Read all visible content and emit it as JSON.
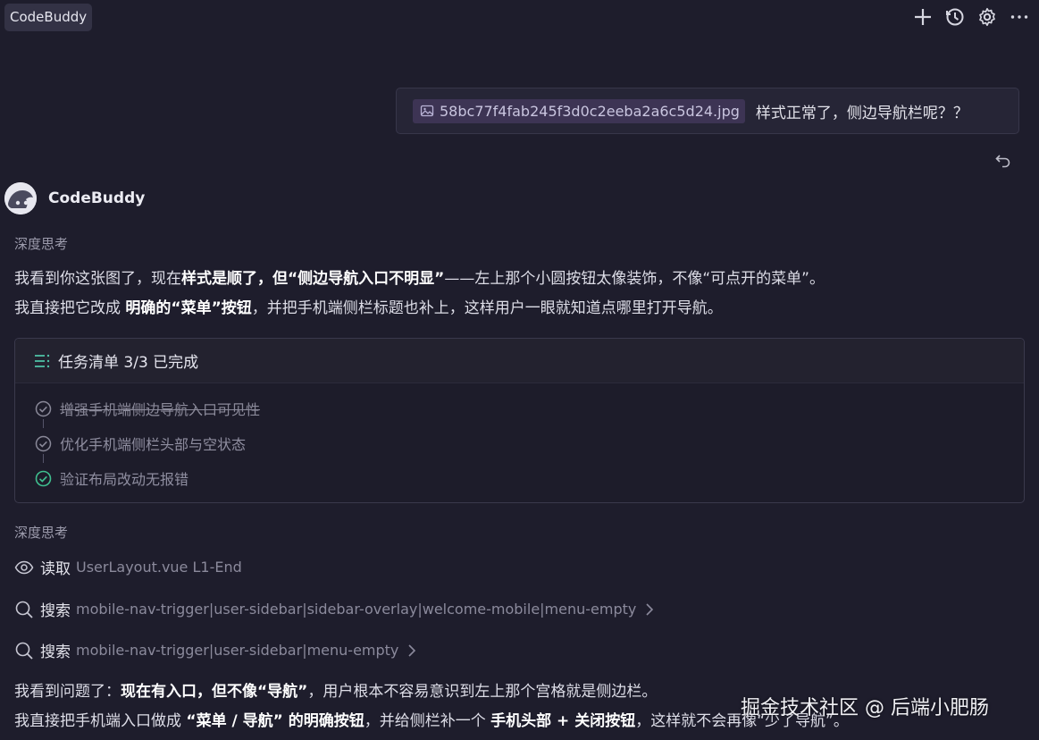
{
  "app": {
    "title": "CodeBuddy"
  },
  "toolbar": {
    "icons": [
      "plus-icon",
      "history-icon",
      "gear-icon",
      "more-icon"
    ]
  },
  "user_message": {
    "attachment": "58bc77f4fab245f3d0c2eeba2a6c5d24.jpg",
    "text": "样式正常了，侧边导航栏呢？？"
  },
  "assistant": {
    "name": "CodeBuddy",
    "thinking_label_1": "深度思考",
    "para1": {
      "line1": [
        {
          "t": "我看到你这张图了，现在",
          "b": false
        },
        {
          "t": "样式是顺了，但“侧边导航入口不明显”",
          "b": true
        },
        {
          "t": "——左上那个小圆按钮太像装饰，不像“可点开的菜单”。",
          "b": false
        }
      ],
      "line2": [
        {
          "t": "我直接把它改成 ",
          "b": false
        },
        {
          "t": "明确的“菜单”按钮",
          "b": true
        },
        {
          "t": "，并把手机端侧栏标题也补上，这样用户一眼就知道点哪里打开导航。",
          "b": false
        }
      ]
    },
    "tasklist": {
      "title": "任务清单 3/3 已完成",
      "items": [
        {
          "label": "增强手机端侧边导航入口可见性",
          "done": true
        },
        {
          "label": "优化手机端侧栏头部与空状态",
          "done": true
        },
        {
          "label": "验证布局改动无报错",
          "done": true
        }
      ]
    },
    "thinking_label_2": "深度思考",
    "tools": [
      {
        "verb": "读取",
        "arg": "UserLayout.vue L1-End",
        "icon": "eye-icon"
      },
      {
        "verb": "搜索",
        "arg": "mobile-nav-trigger|user-sidebar|sidebar-overlay|welcome-mobile|menu-empty",
        "icon": "search-icon"
      },
      {
        "verb": "搜索",
        "arg": "mobile-nav-trigger|user-sidebar|menu-empty",
        "icon": "search-icon"
      }
    ],
    "para2": {
      "line1": [
        {
          "t": "我看到问题了：",
          "b": false
        },
        {
          "t": "现在有入口，但不像“导航”",
          "b": true
        },
        {
          "t": "，用户根本不容易意识到左上那个宫格就是侧边栏。",
          "b": false
        }
      ],
      "line2": [
        {
          "t": "我直接把手机端入口做成 ",
          "b": false
        },
        {
          "t": "“菜单 / 导航” 的明确按钮",
          "b": true
        },
        {
          "t": "，并给侧栏补一个 ",
          "b": false
        },
        {
          "t": "手机头部 + 关闭按钮",
          "b": true
        },
        {
          "t": "，这样就不会再像“少了导航”。",
          "b": false
        }
      ]
    }
  },
  "watermark": "掘金技术社区 @ 后端小肥肠",
  "colors": {
    "background": "#1e1d2c",
    "done_check": "#3fbf8f",
    "chip": "#3d3454"
  }
}
